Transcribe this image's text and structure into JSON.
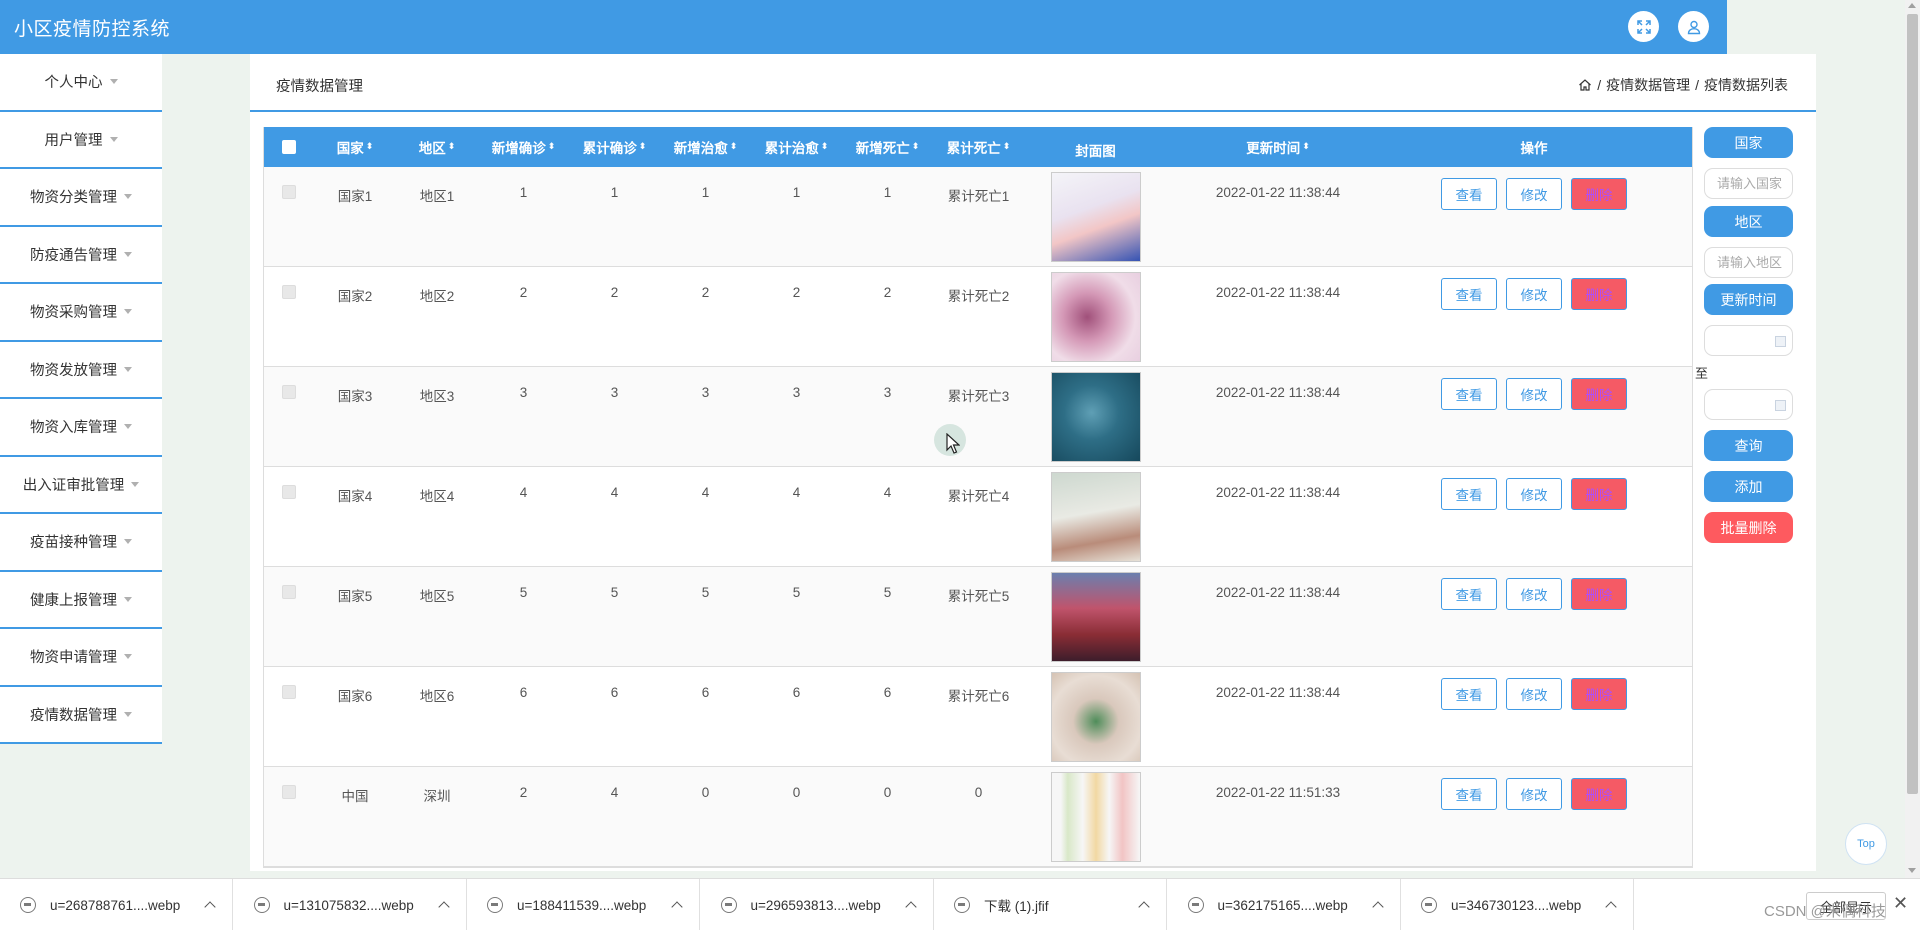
{
  "app": {
    "title": "小区疫情防控系统"
  },
  "header_icons": [
    "fullscreen-icon",
    "user-icon"
  ],
  "sidebar": {
    "items": [
      {
        "label": "个人中心"
      },
      {
        "label": "用户管理"
      },
      {
        "label": "物资分类管理"
      },
      {
        "label": "防疫通告管理"
      },
      {
        "label": "物资采购管理"
      },
      {
        "label": "物资发放管理"
      },
      {
        "label": "物资入库管理"
      },
      {
        "label": "出入证审批管理"
      },
      {
        "label": "疫苗接种管理"
      },
      {
        "label": "健康上报管理"
      },
      {
        "label": "物资申请管理"
      },
      {
        "label": "疫情数据管理"
      }
    ]
  },
  "page": {
    "title": "疫情数据管理",
    "breadcrumb": [
      "疫情数据管理",
      "疫情数据列表"
    ],
    "breadcrumb_sep": "/"
  },
  "table": {
    "columns": [
      "国家",
      "地区",
      "新增确诊",
      "累计确诊",
      "新增治愈",
      "累计治愈",
      "新增死亡",
      "累计死亡",
      "封面图",
      "更新时间",
      "操作"
    ],
    "rows": [
      {
        "country": "国家1",
        "region": "地区1",
        "new_confirmed": "1",
        "total_confirmed": "1",
        "new_cured": "1",
        "total_cured": "1",
        "new_deaths": "1",
        "total_deaths": "累计死亡1",
        "updated": "2022-01-22 11:38:44"
      },
      {
        "country": "国家2",
        "region": "地区2",
        "new_confirmed": "2",
        "total_confirmed": "2",
        "new_cured": "2",
        "total_cured": "2",
        "new_deaths": "2",
        "total_deaths": "累计死亡2",
        "updated": "2022-01-22 11:38:44"
      },
      {
        "country": "国家3",
        "region": "地区3",
        "new_confirmed": "3",
        "total_confirmed": "3",
        "new_cured": "3",
        "total_cured": "3",
        "new_deaths": "3",
        "total_deaths": "累计死亡3",
        "updated": "2022-01-22 11:38:44"
      },
      {
        "country": "国家4",
        "region": "地区4",
        "new_confirmed": "4",
        "total_confirmed": "4",
        "new_cured": "4",
        "total_cured": "4",
        "new_deaths": "4",
        "total_deaths": "累计死亡4",
        "updated": "2022-01-22 11:38:44"
      },
      {
        "country": "国家5",
        "region": "地区5",
        "new_confirmed": "5",
        "total_confirmed": "5",
        "new_cured": "5",
        "total_cured": "5",
        "new_deaths": "5",
        "total_deaths": "累计死亡5",
        "updated": "2022-01-22 11:38:44"
      },
      {
        "country": "国家6",
        "region": "地区6",
        "new_confirmed": "6",
        "total_confirmed": "6",
        "new_cured": "6",
        "total_cured": "6",
        "new_deaths": "6",
        "total_deaths": "累计死亡6",
        "updated": "2022-01-22 11:38:44"
      },
      {
        "country": "中国",
        "region": "深圳",
        "new_confirmed": "2",
        "total_confirmed": "4",
        "new_cured": "0",
        "total_cured": "0",
        "new_deaths": "0",
        "total_deaths": "0",
        "updated": "2022-01-22 11:51:33"
      }
    ],
    "actions": {
      "view": "查看",
      "edit": "修改",
      "delete": "删除"
    }
  },
  "search": {
    "country_btn": "国家",
    "country_placeholder": "请输入国家",
    "region_btn": "地区",
    "region_placeholder": "请输入地区",
    "time_btn": "更新时间",
    "to_label": "至",
    "query_btn": "查询",
    "add_btn": "添加",
    "batch_delete_btn": "批量删除"
  },
  "top_button": "Top",
  "downloads": {
    "files": [
      "u=268788761....webp",
      "u=131075832....webp",
      "u=188411539....webp",
      "u=296593813....webp",
      "下载 (1).jfif",
      "u=362175165....webp",
      "u=346730123....webp"
    ],
    "show_all": "全部显示"
  },
  "watermark": "CSDN @米偶科技",
  "colors": {
    "primary": "#409ae4",
    "danger": "#f55a65",
    "delete_text": "#aa4eff"
  }
}
